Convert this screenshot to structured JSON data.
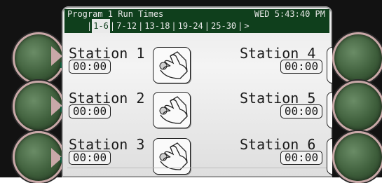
{
  "header": {
    "title": "Program 1 Run Times",
    "datetime": "WED 5:43:40 PM"
  },
  "tabs": [
    {
      "label": "1-6",
      "active": true
    },
    {
      "label": "7-12",
      "active": false
    },
    {
      "label": "13-18",
      "active": false
    },
    {
      "label": "19-24",
      "active": false
    },
    {
      "label": "25-30",
      "active": false
    },
    {
      "label": ">",
      "active": false
    }
  ],
  "stations": [
    {
      "label": "Station 1",
      "time": "00:00"
    },
    {
      "label": "Station 2",
      "time": "00:00"
    },
    {
      "label": "Station 3",
      "time": "00:00"
    },
    {
      "label": "Station 4",
      "time": "00:00"
    },
    {
      "label": "Station 5",
      "time": "00:00"
    },
    {
      "label": "Station 6",
      "time": "00:00"
    }
  ],
  "colors": {
    "lcd_dark": "#0f3f1c",
    "knob_green": "#3e5e3b",
    "knob_rim": "#c9a8a8"
  },
  "icons": {
    "station_button": "hand-pressing-knob-icon"
  }
}
